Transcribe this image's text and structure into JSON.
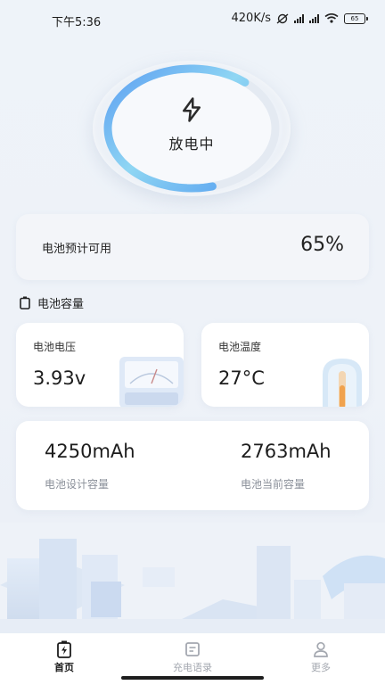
{
  "status_bar": {
    "time": "下午5:36",
    "speed": "420K/s",
    "battery_level": "65"
  },
  "discharge": {
    "status_text": "放电中",
    "icon": "lightning-bolt-icon",
    "level_percent": 65
  },
  "available": {
    "label": "电池预计可用",
    "value": "65%"
  },
  "section": {
    "title": "电池容量",
    "icon": "battery-outline-icon"
  },
  "voltage": {
    "label": "电池电压",
    "value": "3.93v"
  },
  "temperature": {
    "label": "电池温度",
    "value": "27°C"
  },
  "capacity": {
    "design_value": "4250mAh",
    "design_label": "电池设计容量",
    "current_value": "2763mAh",
    "current_label": "电池当前容量"
  },
  "tabbar": {
    "home": "首页",
    "quotes": "充电语录",
    "more": "更多"
  },
  "colors": {
    "accent_blue": "#5aa0f0",
    "arc_light": "#8fd3f4",
    "tab_inactive": "#a4a8b0"
  }
}
